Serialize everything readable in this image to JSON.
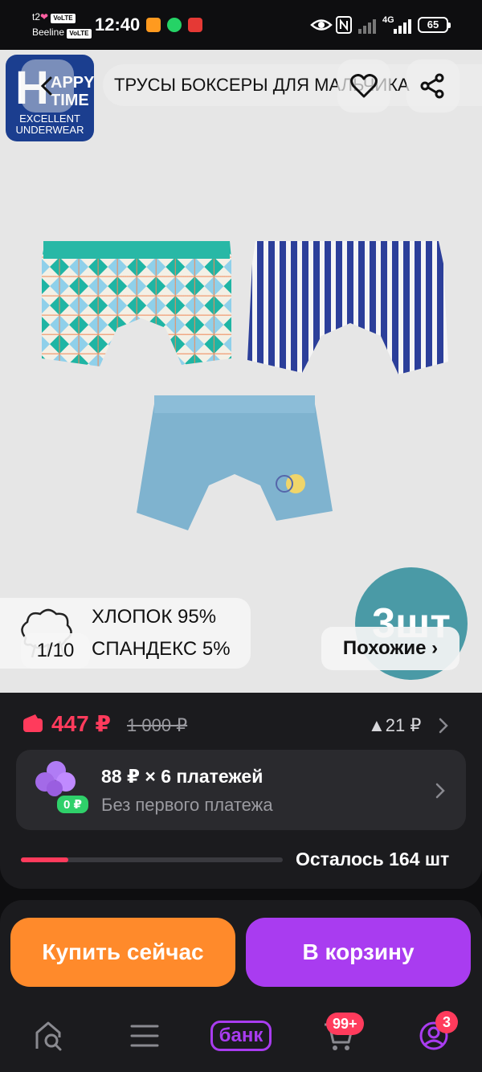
{
  "status_bar": {
    "carrier1": "t2",
    "carrier2": "Beeline",
    "volte": "VoLTE",
    "time": "12:40",
    "network": "4G",
    "battery": "65"
  },
  "header": {
    "title": "ТРУСЫ БОКСЕРЫ ДЛЯ МАЛЬЧИКА",
    "brand": {
      "line1": "APPY",
      "line2": "TIME",
      "letter": "H",
      "line3": "EXCELLENT",
      "line4": "UNDERWEAR"
    }
  },
  "gallery": {
    "counter": "1/10",
    "composition": {
      "line1": "ХЛОПОК 95%",
      "line2": "СПАНДЕКС 5%"
    },
    "pack_badge": "3шт",
    "similar_label": "Похожие ›"
  },
  "price": {
    "current": "447 ₽",
    "old": "1 000 ₽",
    "delta": "▲21 ₽"
  },
  "installment": {
    "title": "88 ₽ × 6 платежей",
    "subtitle": "Без первого платежа",
    "badge": "0 ₽"
  },
  "stock": {
    "label": "Осталось 164 шт",
    "fraction": 0.18
  },
  "actions": {
    "buy_now": "Купить сейчас",
    "add_to_cart": "В корзину"
  },
  "bottom_nav": {
    "bank_label": "банк",
    "cart_badge": "99+",
    "profile_badge": "3"
  },
  "colors": {
    "accent": "#ff3b5c",
    "buy": "#ff8a2b",
    "cart": "#a93cf0",
    "brand_blue": "#1b3e8f",
    "pack_badge": "#4a9aa6"
  }
}
